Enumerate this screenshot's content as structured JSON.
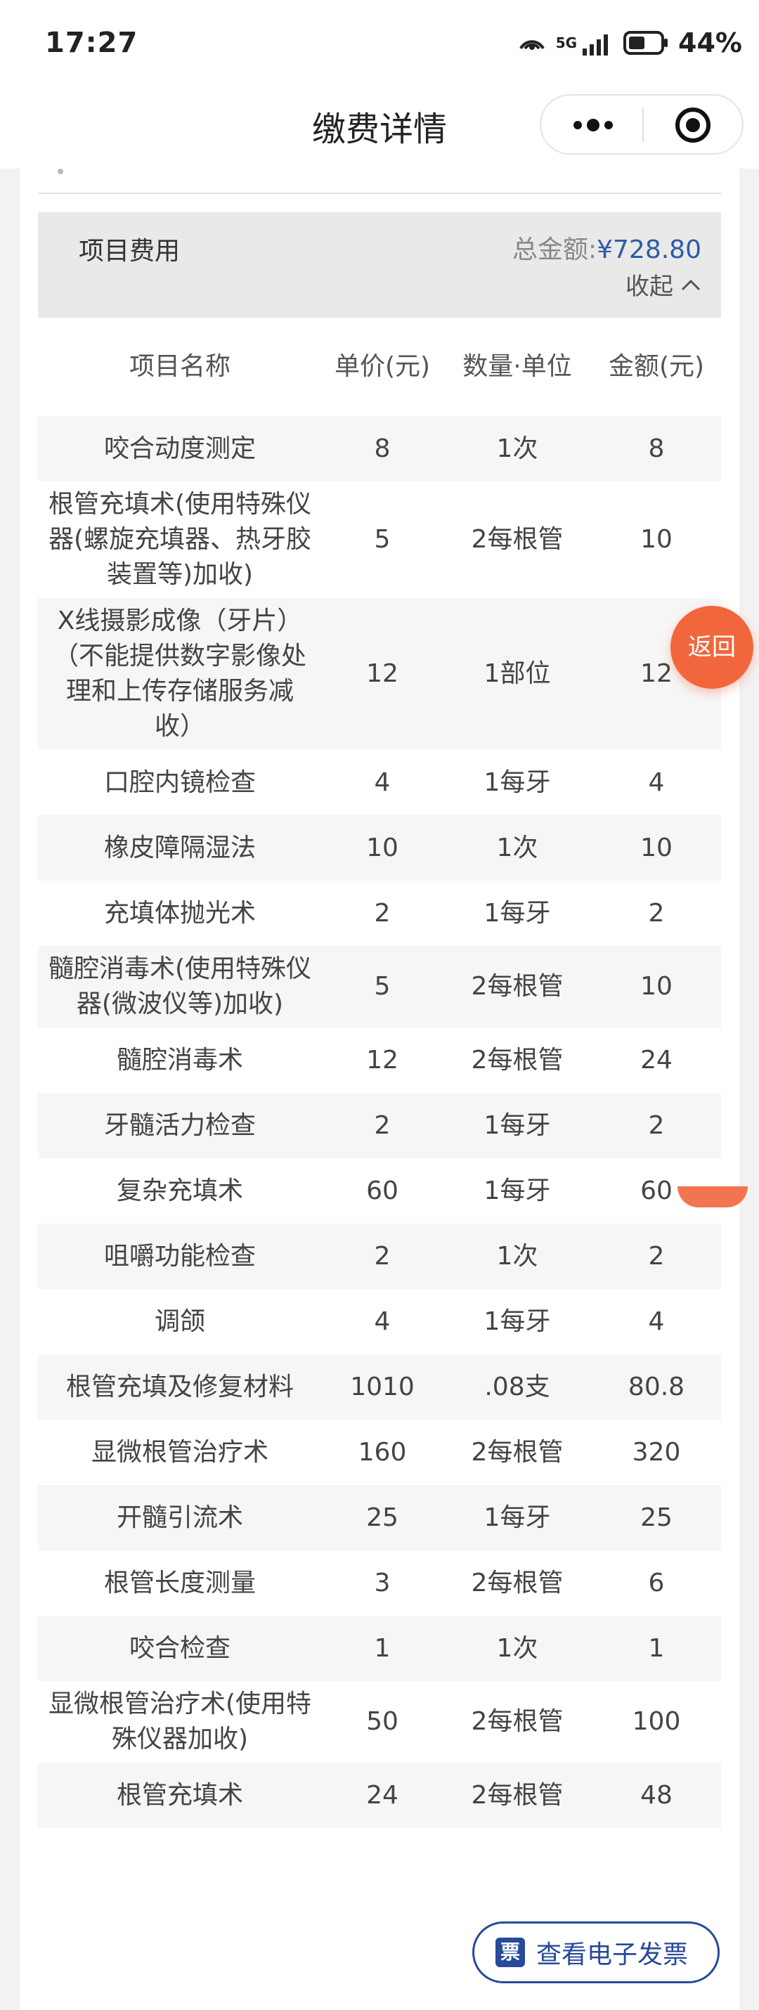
{
  "status_bar": {
    "time": "17:27",
    "signal_label": "5G",
    "battery": "44%"
  },
  "nav": {
    "title": "缴费详情"
  },
  "summary": {
    "title": "项目费用",
    "total_label": "总金额:",
    "total_amount": "¥728.80",
    "collapse_label": "收起"
  },
  "table": {
    "headers": [
      "项目名称",
      "单价(元)",
      "数量·单位",
      "金额(元)"
    ],
    "rows": [
      {
        "name": "咬合动度测定",
        "price": "8",
        "qty": "1次",
        "amount": "8"
      },
      {
        "name": "根管充填术(使用特殊仪器(螺旋充填器、热牙胶装置等)加收)",
        "price": "5",
        "qty": "2每根管",
        "amount": "10"
      },
      {
        "name": "X线摄影成像（牙片）（不能提供数字影像处理和上传存储服务减收）",
        "price": "12",
        "qty": "1部位",
        "amount": "12"
      },
      {
        "name": "口腔内镜检查",
        "price": "4",
        "qty": "1每牙",
        "amount": "4"
      },
      {
        "name": "橡皮障隔湿法",
        "price": "10",
        "qty": "1次",
        "amount": "10"
      },
      {
        "name": "充填体抛光术",
        "price": "2",
        "qty": "1每牙",
        "amount": "2"
      },
      {
        "name": "髓腔消毒术(使用特殊仪器(微波仪等)加收)",
        "price": "5",
        "qty": "2每根管",
        "amount": "10"
      },
      {
        "name": "髓腔消毒术",
        "price": "12",
        "qty": "2每根管",
        "amount": "24"
      },
      {
        "name": "牙髓活力检查",
        "price": "2",
        "qty": "1每牙",
        "amount": "2"
      },
      {
        "name": "复杂充填术",
        "price": "60",
        "qty": "1每牙",
        "amount": "60"
      },
      {
        "name": "咀嚼功能检查",
        "price": "2",
        "qty": "1次",
        "amount": "2"
      },
      {
        "name": "调颌",
        "price": "4",
        "qty": "1每牙",
        "amount": "4"
      },
      {
        "name": "根管充填及修复材料",
        "price": "1010",
        "qty": ".08支",
        "amount": "80.8"
      },
      {
        "name": "显微根管治疗术",
        "price": "160",
        "qty": "2每根管",
        "amount": "320"
      },
      {
        "name": "开髓引流术",
        "price": "25",
        "qty": "1每牙",
        "amount": "25"
      },
      {
        "name": "根管长度测量",
        "price": "3",
        "qty": "2每根管",
        "amount": "6"
      },
      {
        "name": "咬合检查",
        "price": "1",
        "qty": "1次",
        "amount": "1"
      },
      {
        "name": "显微根管治疗术(使用特殊仪器加收)",
        "price": "50",
        "qty": "2每根管",
        "amount": "100"
      },
      {
        "name": "根管充填术",
        "price": "24",
        "qty": "2每根管",
        "amount": "48"
      }
    ]
  },
  "back_button": {
    "label": "返回"
  },
  "invoice_button": {
    "icon_text": "票",
    "label": "查看电子发票"
  },
  "colors": {
    "accent_blue": "#2d5aa6",
    "back_orange": "#f2663d",
    "invoice_blue": "#274a9a"
  }
}
